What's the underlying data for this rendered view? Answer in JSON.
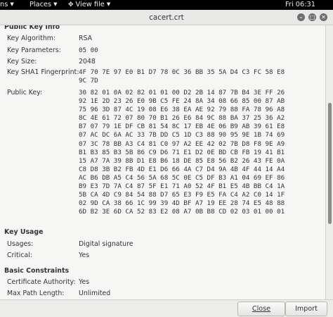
{
  "topbar": {
    "menu_fragment": "ns",
    "places": "Places",
    "view_file": "View file",
    "clock": "Fri 06:31"
  },
  "window": {
    "title": "cacert.crt"
  },
  "public_key_info": {
    "heading": "Public Key Info",
    "algorithm_label": "Key Algorithm:",
    "algorithm_value": "RSA",
    "parameters_label": "Key Parameters:",
    "parameters_value": "05 00",
    "size_label": "Key Size:",
    "size_value": "2048",
    "fingerprint_label": "Key SHA1 Fingerprint:",
    "fingerprint_value": "4F 70 7E 97 E0 B1 D7 78 0C 36 BB 35 5A D4 C3 FC 58 E8\n9C 7D",
    "public_key_label": "Public Key:",
    "public_key_value": "30 82 01 0A 02 82 01 01 00 D2 2B 14 87 7B B4 3E FF 26\n92 1E 2D 23 26 E0 9B C5 FE 24 8A 34 08 66 85 00 87 AB\n75 96 3D 87 4C 19 08 E6 38 EA AE 92 79 88 FA 78 96 A8\n8C 4E 61 72 07 80 70 B1 26 E6 84 9C 88 BA 37 25 36 A2\nB7 07 79 1E DF CB 81 54 8C 17 EB 4E 06 B9 AB 39 61 E8\n07 AC DC 6A AC 33 7B DD C5 1D C3 88 90 95 9E 1B 74 69\n07 3C 78 BB A3 C4 81 C0 97 A2 EE 42 02 7B D8 F8 9E A9\nB1 B3 85 B3 5B 86 C9 D6 71 E1 D2 0E BD CB FB 19 41 B1\n15 A7 7A 39 8B D1 E8 B6 18 DE 85 E8 56 B2 26 43 FE 0A\nC8 D8 3B B2 FB 4D E1 D6 66 4A C7 D4 9A 4B 4F 44 14 A4\nAC B6 DB A5 C4 56 5A 68 5C 0E C5 DF B3 A1 04 69 EF 86\nB9 E3 7D 7A C4 87 5F E1 71 A0 52 4F B1 E5 4B BB C4 1A\n5B CA 4D C9 84 54 88 D7 65 E3 F9 E5 FA C4 A2 C0 14 1F\n02 9D CA 38 66 1C 99 39 4D BF A7 19 EE 28 74 E5 48 88\n6D B2 3E 6D CA 52 83 E2 08 A7 0B B8 CD 02 03 01 00 01"
  },
  "key_usage": {
    "heading": "Key Usage",
    "usages_label": "Usages:",
    "usages_value": "Digital signature",
    "critical_label": "Critical:",
    "critical_value": "Yes"
  },
  "basic_constraints": {
    "heading": "Basic Constraints",
    "ca_label": "Certificate Authority:",
    "ca_value": "Yes",
    "path_label": "Max Path Length:",
    "path_value": "Unlimited"
  },
  "buttons": {
    "close": "Close",
    "import": "Import"
  }
}
